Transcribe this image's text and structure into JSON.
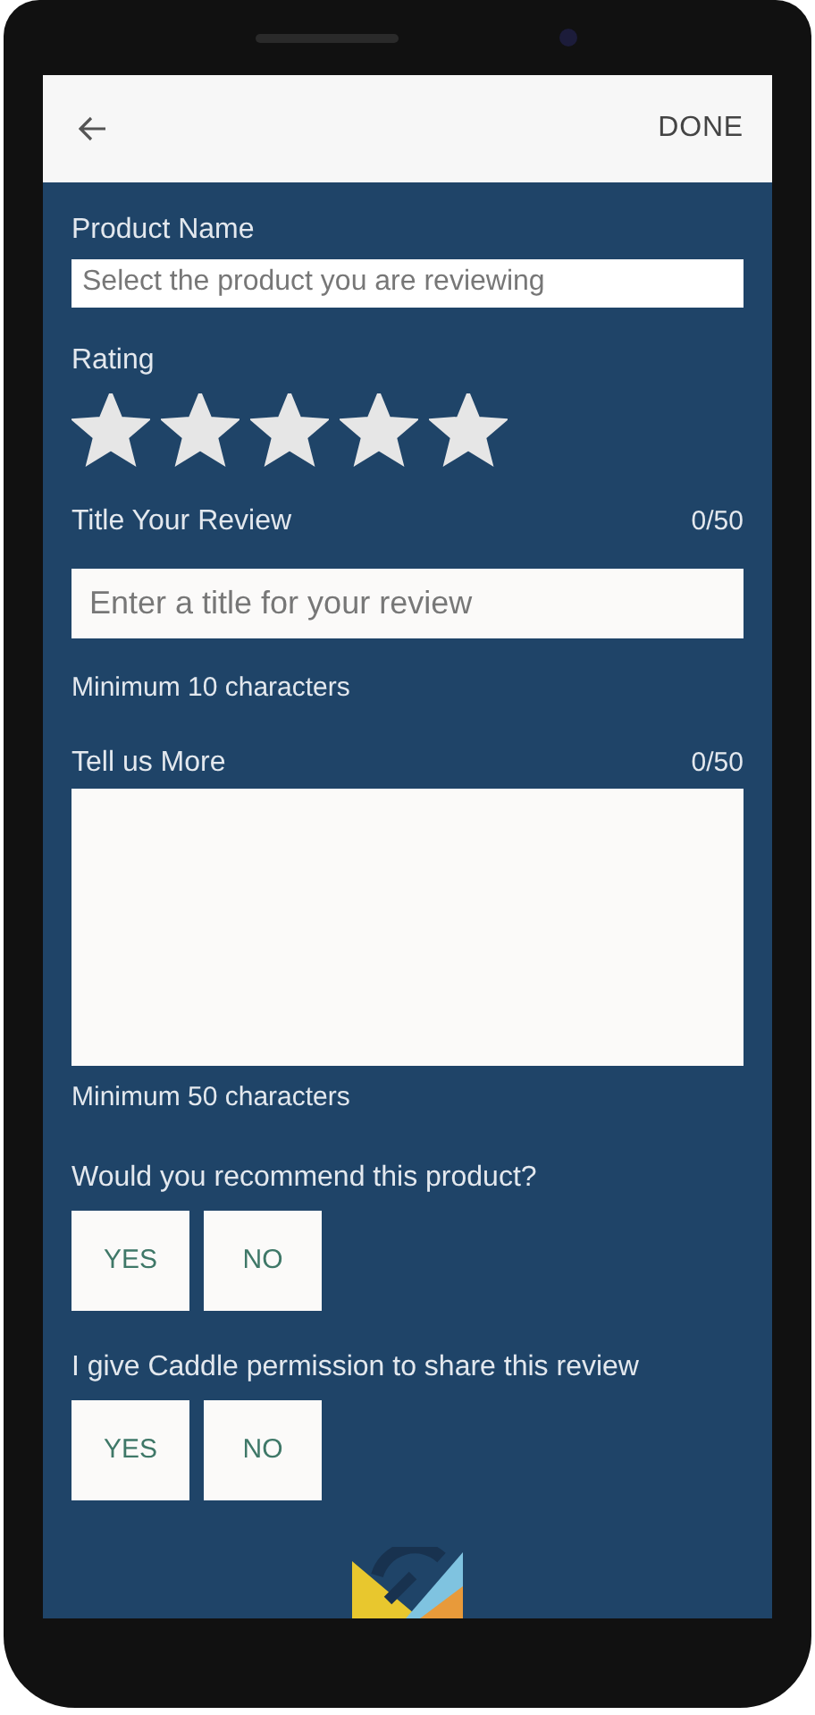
{
  "header": {
    "action": "DONE"
  },
  "product": {
    "label": "Product Name",
    "placeholder": "Select the product you are reviewing"
  },
  "rating": {
    "label": "Rating",
    "stars": 5
  },
  "title_field": {
    "label": "Title Your Review",
    "counter": "0/50",
    "placeholder": "Enter a title for your review",
    "hint": "Minimum 10 characters"
  },
  "more_field": {
    "label": "Tell us More",
    "counter": "0/50",
    "hint": "Minimum 50 characters"
  },
  "questions": [
    {
      "label": "Would you recommend this product?",
      "options": [
        {
          "label": "YES",
          "selected": false
        },
        {
          "label": "NO",
          "selected": false
        }
      ]
    },
    {
      "label": "I give Caddle permission to share this review",
      "options": [
        {
          "label": "YES",
          "selected": false
        },
        {
          "label": "NO",
          "selected": false
        }
      ]
    }
  ]
}
